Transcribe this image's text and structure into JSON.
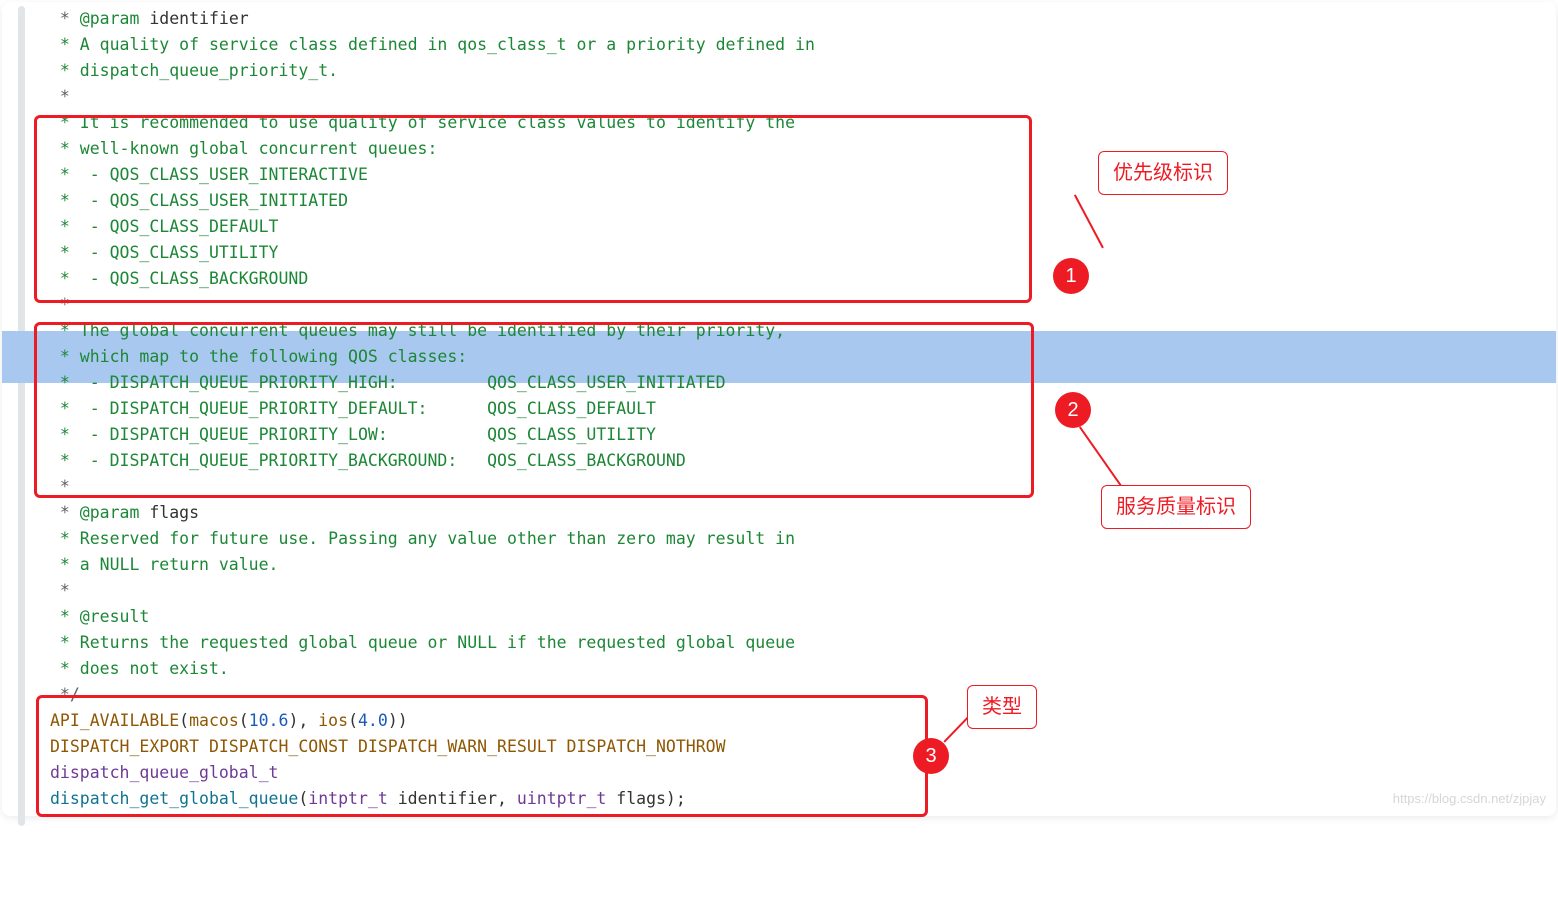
{
  "code": {
    "l01": " * @param identifier",
    "l02": " * A quality of service class defined in qos_class_t or a priority defined in",
    "l03": " * dispatch_queue_priority_t.",
    "l04": " *",
    "l05": " * It is recommended to use quality of service class values to identify the",
    "l06": " * well-known global concurrent queues:",
    "l07": " *  - QOS_CLASS_USER_INTERACTIVE",
    "l08": " *  - QOS_CLASS_USER_INITIATED",
    "l09": " *  - QOS_CLASS_DEFAULT",
    "l10": " *  - QOS_CLASS_UTILITY",
    "l11": " *  - QOS_CLASS_BACKGROUND",
    "l12": " *",
    "l13": " * The global concurrent queues may still be identified by their priority,",
    "l14": " * which map to the following QOS classes:",
    "l15": " *  - DISPATCH_QUEUE_PRIORITY_HIGH:         QOS_CLASS_USER_INITIATED",
    "l16": " *  - DISPATCH_QUEUE_PRIORITY_DEFAULT:      QOS_CLASS_DEFAULT",
    "l17": " *  - DISPATCH_QUEUE_PRIORITY_LOW:          QOS_CLASS_UTILITY",
    "l18": " *  - DISPATCH_QUEUE_PRIORITY_BACKGROUND:   QOS_CLASS_BACKGROUND",
    "l19": " *",
    "l20": " * @param flags",
    "l21": " * Reserved for future use. Passing any value other than zero may result in",
    "l22": " * a NULL return value.",
    "l23": " *",
    "l24": " * @result",
    "l25": " * Returns the requested global queue or NULL if the requested global queue",
    "l26": " * does not exist.",
    "l27": " */",
    "l28_api": "API_AVAILABLE",
    "l28_macos": "macos",
    "l28_macos_v": "10.6",
    "l28_ios": "ios",
    "l28_ios_v": "4.0",
    "l29": "DISPATCH_EXPORT DISPATCH_CONST DISPATCH_WARN_RESULT DISPATCH_NOTHROW",
    "l30": "dispatch_queue_global_t",
    "l31_fn": "dispatch_get_global_queue",
    "l31_t1": "intptr_t",
    "l31_p1": " identifier, ",
    "l31_t2": "uintptr_t",
    "l31_p2": " flags);"
  },
  "annotations": {
    "label1": "优先级标识",
    "bubble1": "1",
    "label2": "服务质量标识",
    "bubble2": "2",
    "label3": "类型",
    "bubble3": "3"
  },
  "watermark": "https://blog.csdn.net/zjpjay"
}
